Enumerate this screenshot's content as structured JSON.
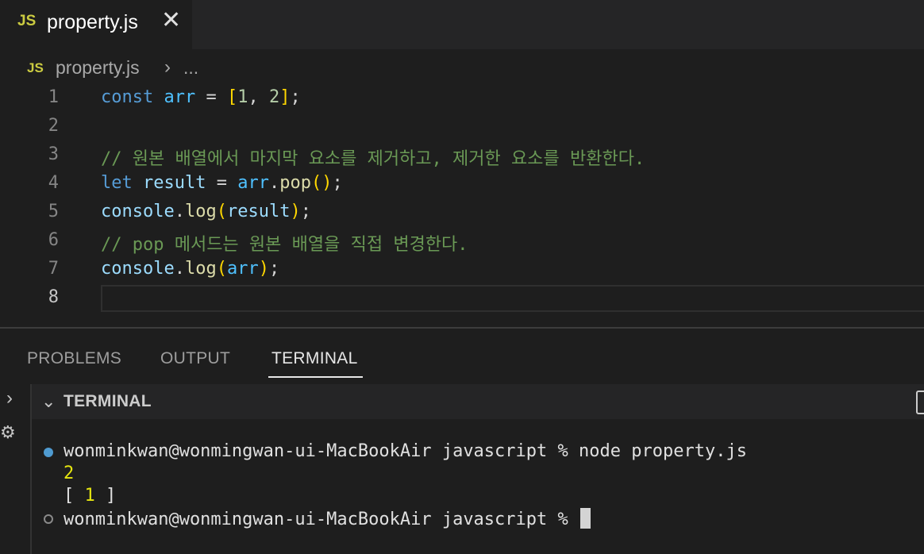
{
  "tab": {
    "lang_icon": "JS",
    "title": "property.js",
    "close_icon": "✕"
  },
  "breadcrumb": {
    "lang_icon": "JS",
    "file": "property.js",
    "separator": "›",
    "more": "..."
  },
  "editor": {
    "line_numbers": [
      "1",
      "2",
      "3",
      "4",
      "5",
      "6",
      "7",
      "8"
    ],
    "active_line": "8",
    "lines": [
      [
        {
          "t": "const",
          "c": "kw"
        },
        {
          "t": " "
        },
        {
          "t": "arr",
          "c": "var"
        },
        {
          "t": " = "
        },
        {
          "t": "[",
          "c": "br"
        },
        {
          "t": "1",
          "c": "num"
        },
        {
          "t": ", "
        },
        {
          "t": "2",
          "c": "num"
        },
        {
          "t": "]",
          "c": "br"
        },
        {
          "t": ";"
        }
      ],
      [],
      [
        {
          "t": "// 원본 배열에서 마지막 요소를 제거하고, 제거한 요소를 반환한다.",
          "c": "cm"
        }
      ],
      [
        {
          "t": "let",
          "c": "kw"
        },
        {
          "t": " "
        },
        {
          "t": "result",
          "c": "prop"
        },
        {
          "t": " = "
        },
        {
          "t": "arr",
          "c": "var"
        },
        {
          "t": "."
        },
        {
          "t": "pop",
          "c": "fn"
        },
        {
          "t": "()",
          "c": "br"
        },
        {
          "t": ";"
        }
      ],
      [
        {
          "t": "console",
          "c": "prop"
        },
        {
          "t": "."
        },
        {
          "t": "log",
          "c": "fn"
        },
        {
          "t": "(",
          "c": "br"
        },
        {
          "t": "result",
          "c": "prop"
        },
        {
          "t": ")",
          "c": "br"
        },
        {
          "t": ";"
        }
      ],
      [
        {
          "t": "// pop 메서드는 원본 배열을 직접 변경한다.",
          "c": "cm"
        }
      ],
      [
        {
          "t": "console",
          "c": "prop"
        },
        {
          "t": "."
        },
        {
          "t": "log",
          "c": "fn"
        },
        {
          "t": "(",
          "c": "br"
        },
        {
          "t": "arr",
          "c": "var"
        },
        {
          "t": ")",
          "c": "br"
        },
        {
          "t": ";"
        }
      ],
      []
    ]
  },
  "panel": {
    "tabs": [
      "PROBLEMS",
      "OUTPUT",
      "TERMINAL"
    ],
    "active_tab": "TERMINAL",
    "terminal_header": "TERMINAL"
  },
  "terminal": {
    "prompt": "wonminkwan@wonmingwan-ui-MacBookAir javascript % ",
    "command": "node property.js",
    "output_1": "2",
    "output_2_open": "[ ",
    "output_2_value": "1",
    "output_2_close": " ]",
    "prompt_2": "wonminkwan@wonmingwan-ui-MacBookAir javascript % "
  },
  "colors": {
    "accent_js": "#cbcb41",
    "terminal_dot": "#4f9bd1"
  }
}
